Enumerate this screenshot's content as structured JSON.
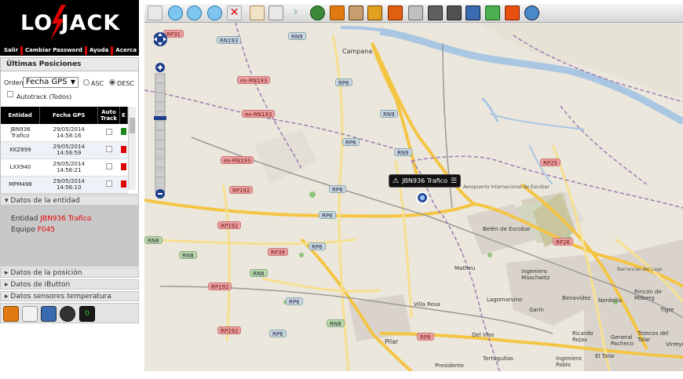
{
  "brand": {
    "logo_text": "LO JACK"
  },
  "top_menu": [
    "Salir",
    "Cambiar Password",
    "Ayuda",
    "Acerca De"
  ],
  "positions": {
    "title": "Últimas Posiciones",
    "order_label": "Orden",
    "order_value": "Fecha GPS",
    "asc_label": "ASC",
    "desc_label": "DESC",
    "autotrack_label": "Autotrack (Todos)",
    "columns": [
      "Entidad",
      "Fecha GPS",
      "Auto Track",
      "E"
    ],
    "rows": [
      {
        "entidad": "JBN936 Trafico",
        "fecha": "29/05/2014 14:58:16",
        "color": "#1a8a1a"
      },
      {
        "entidad": "KKZ899",
        "fecha": "29/05/2014 14:56:59",
        "color": "#e00000"
      },
      {
        "entidad": "LXX940",
        "fecha": "29/05/2014 14:56:21",
        "color": "#e00000"
      },
      {
        "entidad": "MPM498",
        "fecha": "29/05/2014 14:56:10",
        "color": "#e00000"
      }
    ]
  },
  "entity": {
    "section_title": "Datos de la entidad",
    "entidad_label": "Entidad",
    "entidad_value": "JBN936 Trafico",
    "equipo_label": "Equipo",
    "equipo_value": "F045"
  },
  "sections": [
    "Datos de la posición",
    "Datos de iButton",
    "Datos sensores temperatura"
  ],
  "tools": {
    "counter": "0"
  },
  "map": {
    "vehicle_label": "JBN936 Trafico",
    "places": [
      "Campana",
      "Belén de Escobar",
      "Matheu",
      "Ingeniero Maschwitz",
      "Villa Rosa",
      "Lagomarsino",
      "Garín",
      "Benavidez",
      "Nordelta",
      "Rincón de Milberg",
      "Tigre",
      "Pilar",
      "Del Viso",
      "Ricardo Rojas",
      "General Pacheco",
      "Troncos del Talar",
      "Virreyes",
      "Tortuguitas",
      "El Talar",
      "Presidente",
      "Ingeniero Pablo",
      "Barrancas del Lago",
      "Aeropuerto Internacional de Escobar"
    ],
    "roads": [
      "RP31",
      "RN193",
      "RN9",
      "ex-RN193",
      "RP6",
      "RN9",
      "RP6",
      "RN9",
      "ex-RN193",
      "RP25",
      "RP6",
      "RP192",
      "RP6",
      "RP192",
      "RN8",
      "RP26",
      "RN8",
      "RP39",
      "RP6",
      "RN8",
      "RP192",
      "RN8",
      "RP6",
      "RP192",
      "RP8",
      "RP6",
      "RP26",
      "RN9"
    ]
  }
}
